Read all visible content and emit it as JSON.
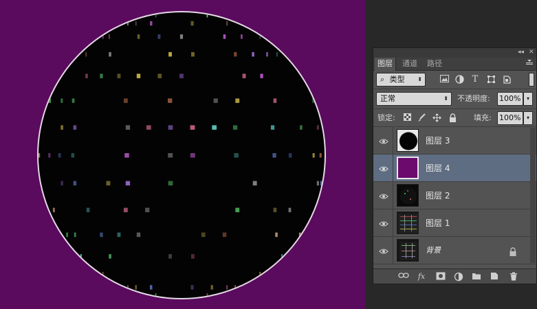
{
  "colors": {
    "canvas_background": "#5a0b5e",
    "selected_layer": "#5f6d82",
    "panel": "#535353"
  },
  "canvas": {
    "content": "disco-ball",
    "tile_colors": [
      "#5ed27a",
      "#e88a5e",
      "#c45fd6",
      "#6a8ee8",
      "#e0e0e0",
      "#d9c24e",
      "#58c8c0",
      "#8a8a8a",
      "#e07090",
      "#4cae5a",
      "#9a6ad0",
      "#c8a080"
    ]
  },
  "panel": {
    "top_buttons": {
      "collapse": "◂◂",
      "close": "✕"
    },
    "tabs": [
      {
        "label": "图层",
        "active": true
      },
      {
        "label": "通道",
        "active": false
      },
      {
        "label": "路径",
        "active": false
      }
    ],
    "menu_icon": "hamburger-menu-icon",
    "filter": {
      "search_glyph": "⌕",
      "kind_label": "类型",
      "icons": [
        "image-filter-icon",
        "adjustment-filter-icon",
        "type-filter-icon",
        "shape-filter-icon",
        "smart-object-filter-icon"
      ]
    },
    "blend": {
      "mode": "正常",
      "opacity_label": "不透明度:",
      "opacity_value": "100%"
    },
    "lock": {
      "label": "锁定:",
      "icons": [
        "lock-transparent-pixels-icon",
        "lock-image-pixels-icon",
        "lock-position-icon",
        "lock-all-icon"
      ],
      "fill_label": "填充:",
      "fill_value": "100%"
    },
    "layers": [
      {
        "name": "图层 3",
        "visible": true,
        "selected": false,
        "thumb": "black-circle"
      },
      {
        "name": "图层 4",
        "visible": true,
        "selected": true,
        "thumb": "purple-fill"
      },
      {
        "name": "图层 2",
        "visible": true,
        "selected": false,
        "thumb": "dark-grid"
      },
      {
        "name": "图层 1",
        "visible": true,
        "selected": false,
        "thumb": "colored-grid"
      },
      {
        "name": "背景",
        "visible": true,
        "selected": false,
        "thumb": "background",
        "locked": true
      }
    ],
    "bottom_icons": [
      "link-layers-icon",
      "fx-icon",
      "add-mask-icon",
      "adjustment-layer-icon",
      "new-group-icon",
      "new-layer-icon",
      "delete-layer-icon"
    ],
    "fx_label": "fx"
  }
}
